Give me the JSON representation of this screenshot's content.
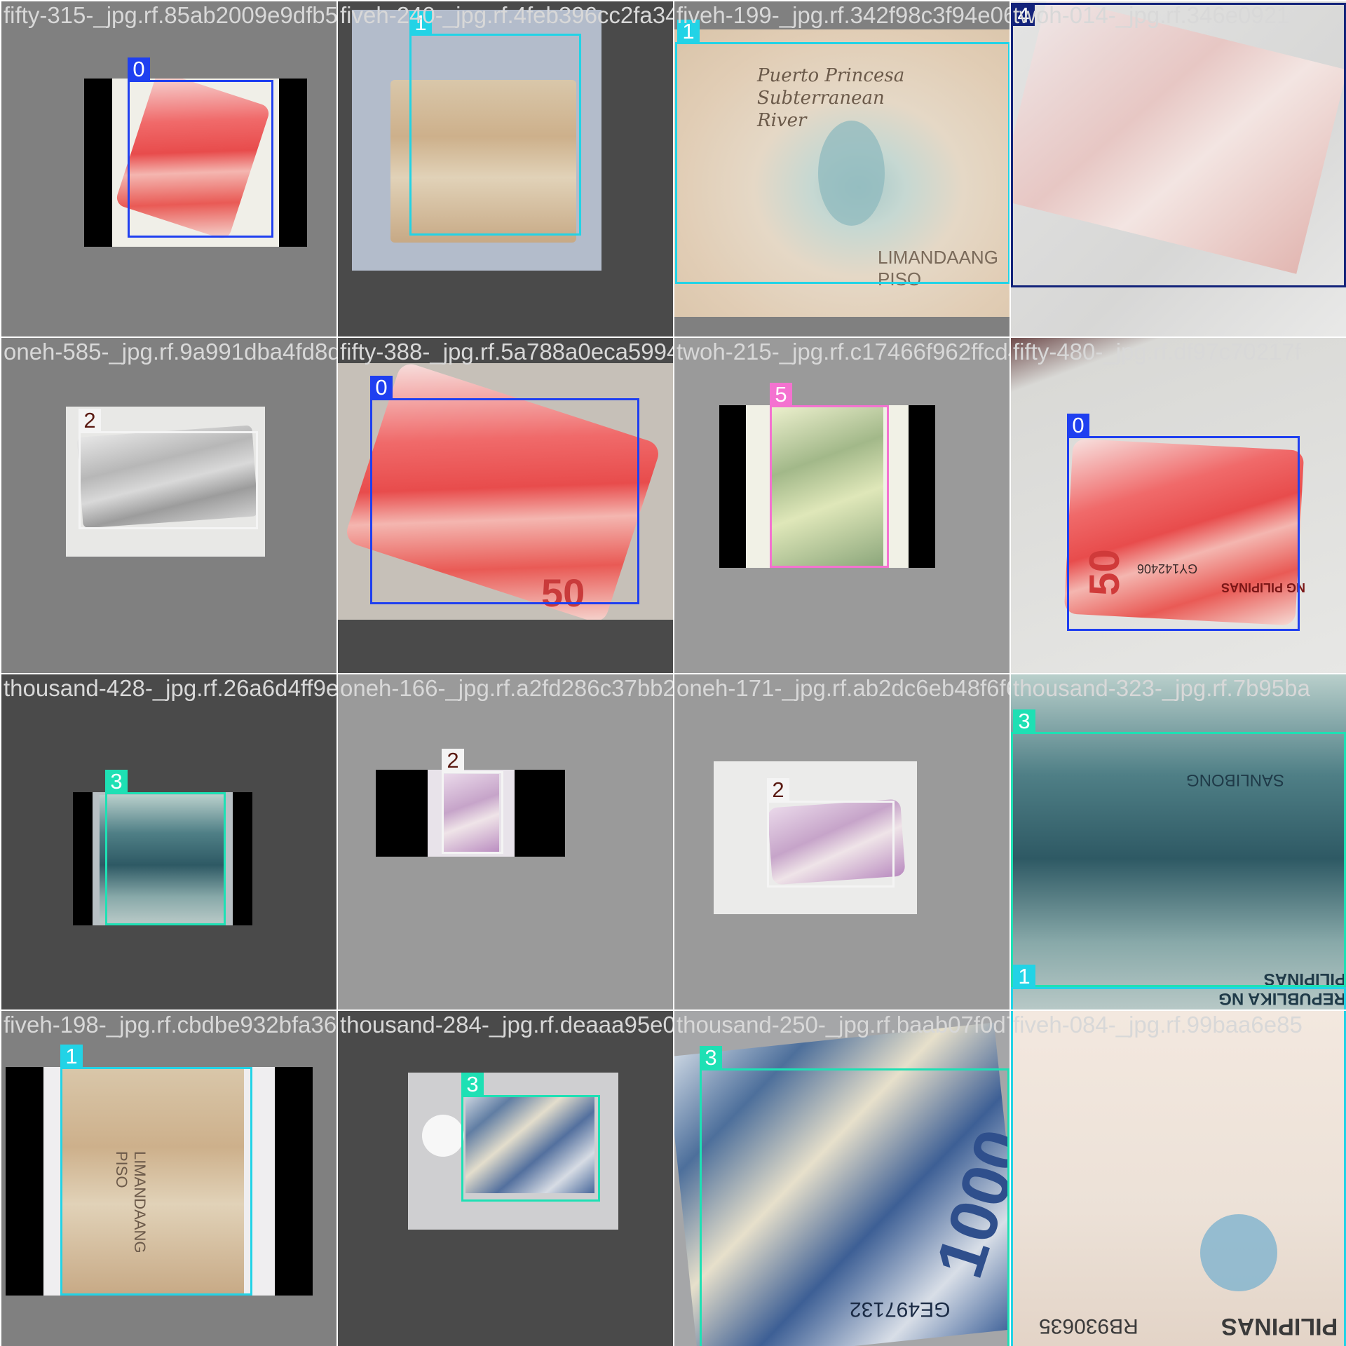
{
  "grid": {
    "tiles": [
      {
        "filename": "fifty-315-_jpg.rf.85ab2009e9dfb5ae40a8e1a1",
        "label": "0",
        "box_color": "#1f3ff0"
      },
      {
        "filename": "fiveh-240-_jpg.rf.4feb396cc2fa34dba40910f",
        "label": "1",
        "box_color": "#22d3e6"
      },
      {
        "filename": "fiveh-199-_jpg.rf.342f98c3f94e06e4e51",
        "label": "1",
        "box_color": "#22d3e6"
      },
      {
        "filename": "twoh-014-_jpg.rf.346e0921",
        "label": "4",
        "box_color": "#13237a"
      },
      {
        "filename": "oneh-585-_jpg.rf.9a991dba4fd8d986c",
        "label": "2",
        "box_color": "#f4f4f4"
      },
      {
        "filename": "fifty-388-_jpg.rf.5a788a0eca59948729658ddc",
        "label": "0",
        "box_color": "#1f3ff0"
      },
      {
        "filename": "twoh-215-_jpg.rf.c17466f962ffcd43f6c0e9c",
        "label": "5",
        "box_color": "#f472d0"
      },
      {
        "filename": "fifty-480-_jpg.rf.df97c70217f",
        "label": "0",
        "box_color": "#1f3ff0"
      },
      {
        "filename": "thousand-428-_jpg.rf.26a6d4ff9eff2061bbd",
        "label": "3",
        "box_color": "#1ee0b4"
      },
      {
        "filename": "oneh-166-_jpg.rf.a2fd286c37bb2eb176fabc22",
        "label": "2",
        "box_color": "#f4f4f4"
      },
      {
        "filename": "oneh-171-_jpg.rf.ab2dc6eb48f6f6c411d2a3e0",
        "label": "2",
        "box_color": "#f4f4f4"
      },
      {
        "filename": "thousand-323-_jpg.rf.7b95ba",
        "label": "3",
        "box_color": "#1ee0b4"
      },
      {
        "filename": "fiveh-198-_jpg.rf.cbdbe932bfa36734ec484b",
        "label": "1",
        "box_color": "#22d3e6"
      },
      {
        "filename": "thousand-284-_jpg.rf.deaaa95e02488b2d0a3",
        "label": "3",
        "box_color": "#1ee0b4"
      },
      {
        "filename": "thousand-250-_jpg.rf.baab07f0d72959eea",
        "label": "3",
        "box_color": "#1ee0b4"
      },
      {
        "filename": "fiveh-084-_jpg.rf.99baa6e85",
        "label": "1",
        "box_color": "#22d3e6"
      }
    ]
  },
  "extra_boxes": [
    {
      "label": "1",
      "box_color": "#22d3e6"
    }
  ],
  "bill_texts": {
    "t2": "LIMANDAANG PISO",
    "t2_title": "Puerto Princesa Subterranean River",
    "t6": "50",
    "t8": "50",
    "t8b": "NG PILIPINAS",
    "t8c": "GY142406",
    "t12": "REPUBLIKA NG PILIPINAS",
    "t12b": "SANLIBONG",
    "t13": "LIMANDAANG PISO",
    "t15": "1000",
    "t15b": "GE497132",
    "t16": "PILIPINAS",
    "t16b": "RB930635"
  }
}
